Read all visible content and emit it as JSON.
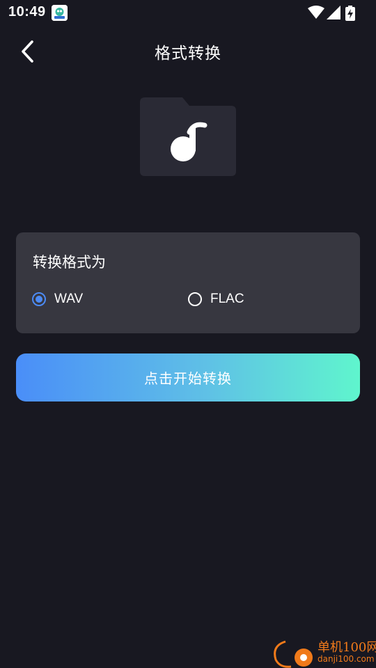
{
  "status_bar": {
    "time": "10:49",
    "icons": [
      "app-notification-icon",
      "wifi-icon",
      "cellular-signal-icon",
      "battery-charging-icon"
    ]
  },
  "header": {
    "back_icon": "chevron-left-icon",
    "title": "格式转换"
  },
  "media": {
    "icon": "music-folder-icon"
  },
  "format_card": {
    "title": "转换格式为",
    "options": [
      {
        "label": "WAV",
        "selected": true
      },
      {
        "label": "FLAC",
        "selected": false
      }
    ]
  },
  "start_button": {
    "label": "点击开始转换"
  },
  "watermark": {
    "brand": "单机100网",
    "url": "danji100.com"
  },
  "colors": {
    "background": "#181821",
    "card": "#373740",
    "accent": "#4c8bf5",
    "gradient_start": "#4a8ef8",
    "gradient_end": "#5ff5cd",
    "watermark": "#f07a1a"
  }
}
